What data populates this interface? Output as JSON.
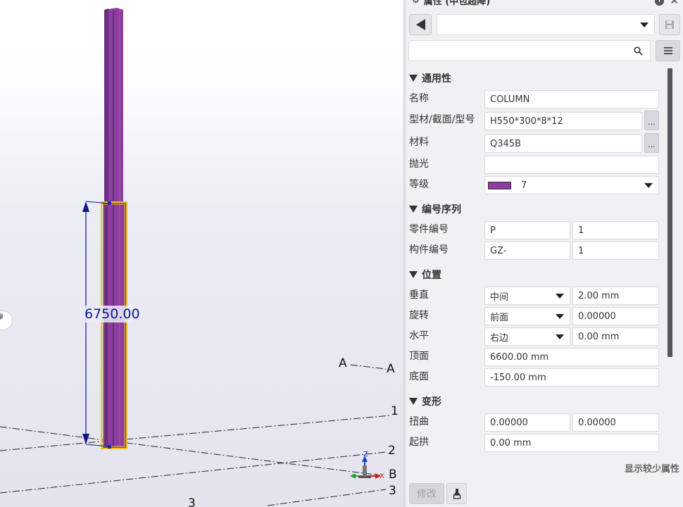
{
  "viewport": {
    "dimension_value": "6750.00",
    "grid_labels": {
      "a_left": "A",
      "a_right": "A",
      "one": "1",
      "two": "2",
      "b": "B",
      "three_right": "3",
      "three_bottom": "3"
    },
    "axis_labels": {
      "z": "Z",
      "x": "X"
    },
    "colors": {
      "column_fill": "#8c3d9f",
      "column_dark": "#5b2a6c",
      "selection": "#f2c21b",
      "dimension": "#0a1a8c"
    }
  },
  "panel": {
    "title": "属性 (中包超降)",
    "back_icon": "back-arrow-icon",
    "save_icon": "save-icon",
    "preset_value": "",
    "search_value": "",
    "sections": {
      "general": "通用性",
      "numbering": "编号序列",
      "position": "位置",
      "deformation": "变形"
    },
    "labels": {
      "name": "名称",
      "profile": "型材/截面/型号",
      "material": "材料",
      "finish": "抛光",
      "class": "等级",
      "part_number": "零件编号",
      "assembly_number": "构件编号",
      "vertical": "垂直",
      "rotation": "旋转",
      "horizontal": "水平",
      "top": "顶面",
      "bottom": "底面",
      "twist": "扭曲",
      "camber": "起拱"
    },
    "values": {
      "name": "COLUMN",
      "profile": "H550*300*8*12",
      "material": "Q345B",
      "finish": "",
      "class": "7",
      "class_color": "#8c3d9f",
      "part_prefix": "P",
      "part_start": "1",
      "assembly_prefix": "GZ-",
      "assembly_start": "1",
      "vertical_option": "中间",
      "vertical_offset": "2.00 mm",
      "rotation_option": "前面",
      "rotation_offset": "0.00000",
      "horizontal_option": "右边",
      "horizontal_offset": "0.00 mm",
      "top": "6600.00 mm",
      "bottom": "-150.00 mm",
      "twist_start": "0.00000",
      "twist_end": "0.00000",
      "camber": "0.00 mm"
    },
    "ellipsis": "...",
    "show_less": "显示较少属性",
    "modify": "修改"
  }
}
